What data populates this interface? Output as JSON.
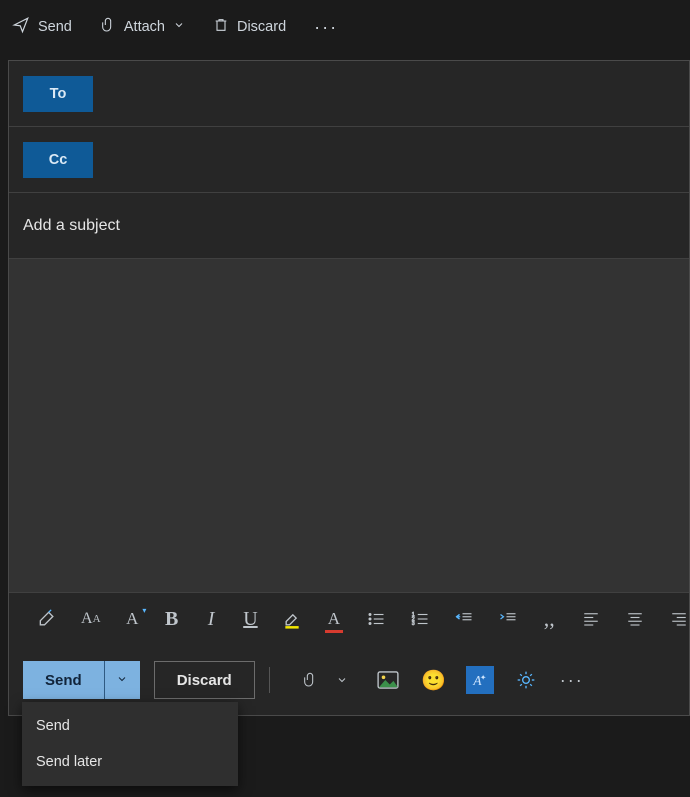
{
  "toolbar": {
    "send": "Send",
    "attach": "Attach",
    "discard": "Discard"
  },
  "fields": {
    "to": "To",
    "cc": "Cc"
  },
  "subject_placeholder": "Add a subject",
  "bottom": {
    "send": "Send",
    "discard": "Discard"
  },
  "send_menu": {
    "send": "Send",
    "send_later": "Send later"
  }
}
